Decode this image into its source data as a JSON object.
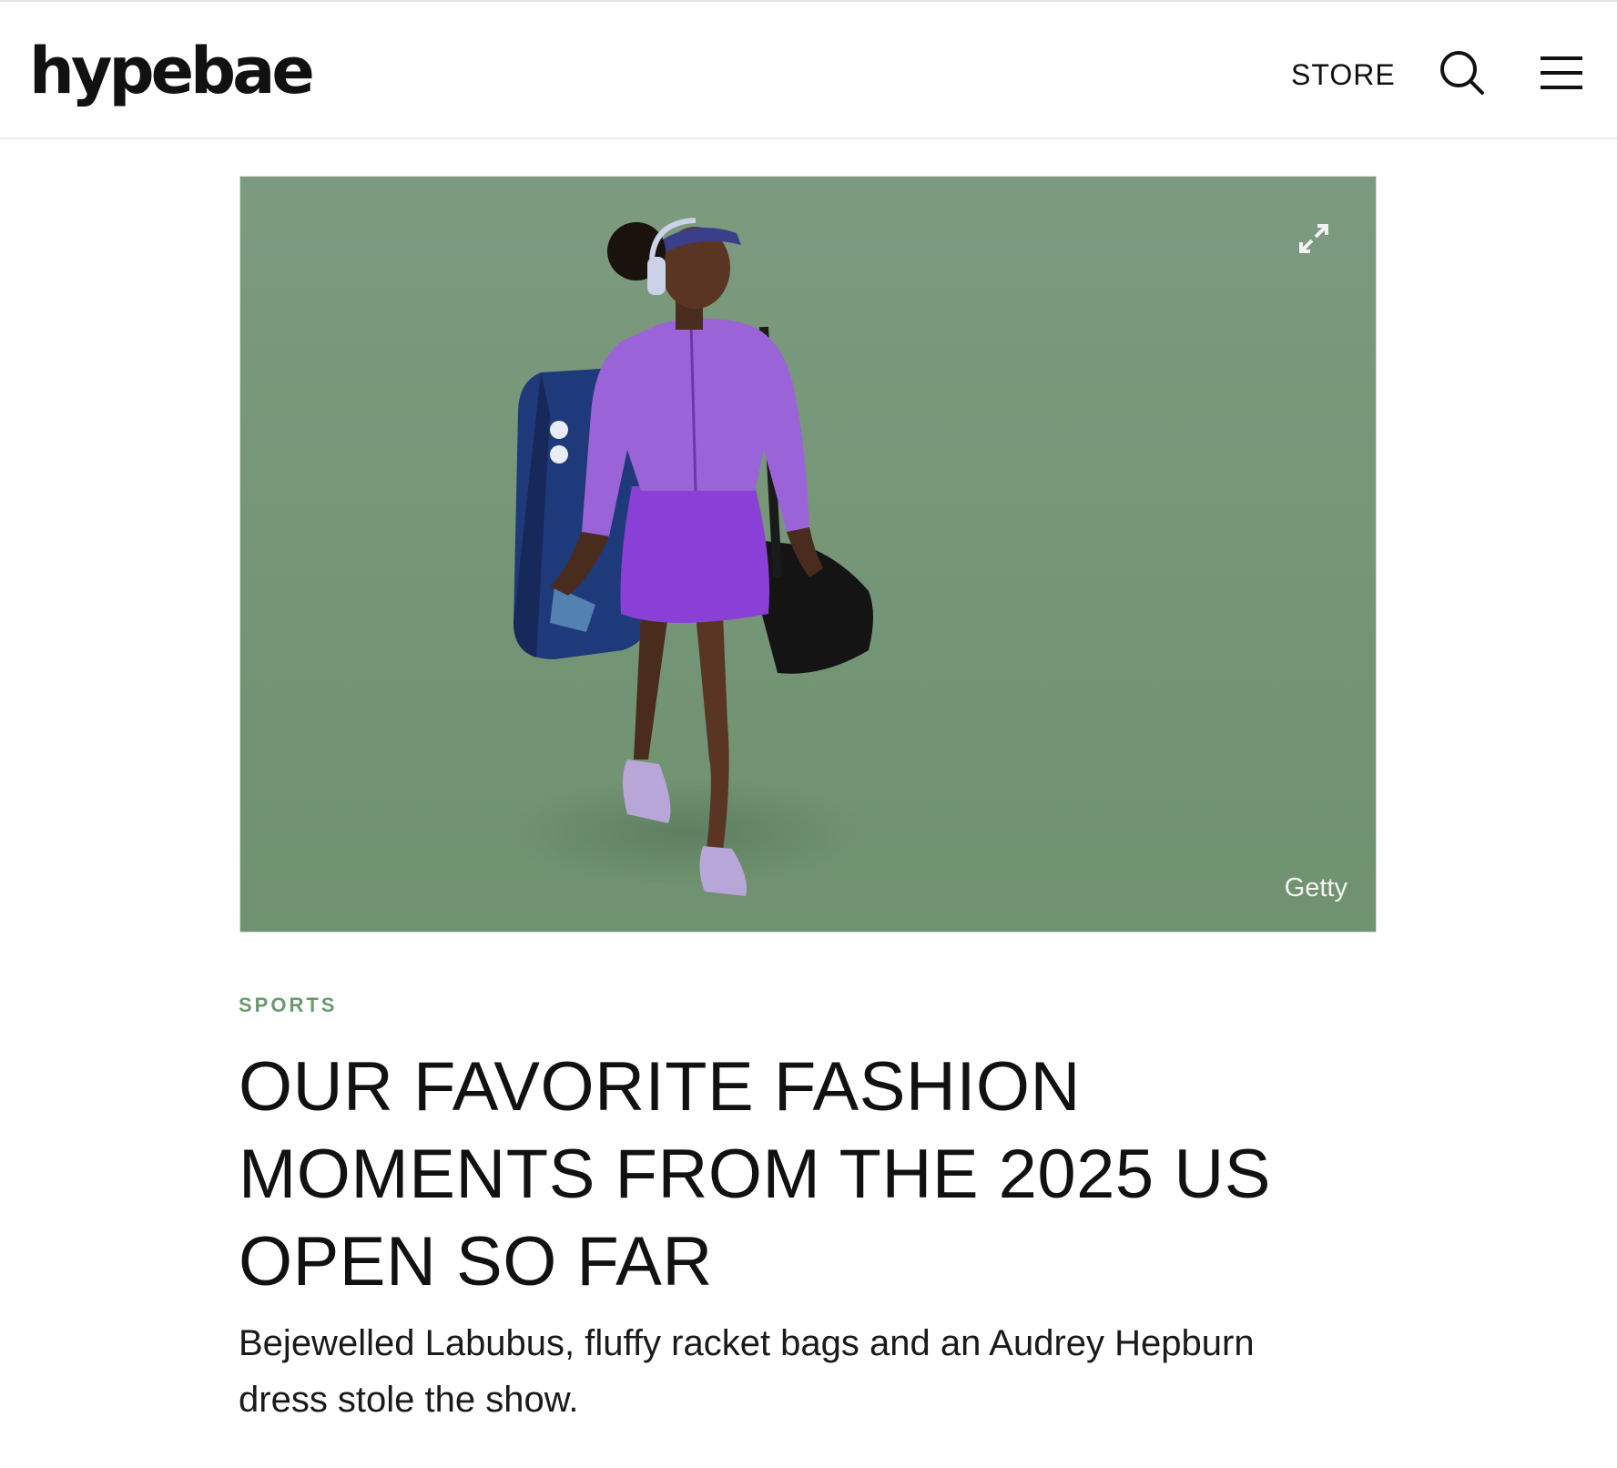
{
  "header": {
    "logo_text": "hypebae",
    "store_label": "STORE",
    "search_icon": "search-icon",
    "menu_icon": "hamburger-menu-icon"
  },
  "hero": {
    "expand_icon": "expand-icon",
    "credit": "Getty",
    "background_color": "#7a9a7d"
  },
  "article": {
    "category": "SPORTS",
    "headline_lines": [
      "OUR FAVORITE FASHION",
      "MOMENTS FROM THE 2025 US",
      "OPEN SO FAR"
    ],
    "subtitle_lines": [
      "Bejewelled Labubus, fluffy racket bags and an Audrey Hepburn",
      "dress stole the show."
    ]
  },
  "colors": {
    "accent_green": "#6b9a6e",
    "text": "#111111"
  }
}
